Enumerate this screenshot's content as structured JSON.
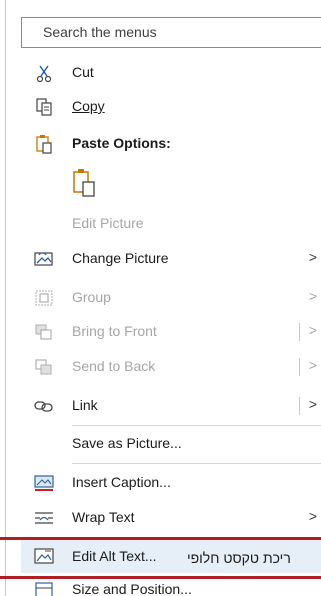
{
  "search": {
    "placeholder": "Search the menus"
  },
  "items": {
    "cut": "Cut",
    "copy": "Copy",
    "paste_options": "Paste Options:",
    "edit_picture": "Edit Picture",
    "change_picture": "Change Picture",
    "group": "Group",
    "bring_to_front": "Bring to Front",
    "send_to_back": "Send to Back",
    "link": "Link",
    "save_as_picture": "Save as Picture...",
    "insert_caption": "Insert Caption...",
    "wrap_text": "Wrap Text",
    "edit_alt_text": "Edit Alt Text...",
    "size_and_position": "Size and Position..."
  },
  "arrows": {
    "submenu": ">"
  },
  "annotation": {
    "hebrew_label": "ריכת טקסט חלופי"
  },
  "colors": {
    "highlight": "#e6eef8",
    "annotation_border": "#b01d22",
    "icon_blue": "#2f5f9e",
    "icon_orange": "#c77700"
  }
}
